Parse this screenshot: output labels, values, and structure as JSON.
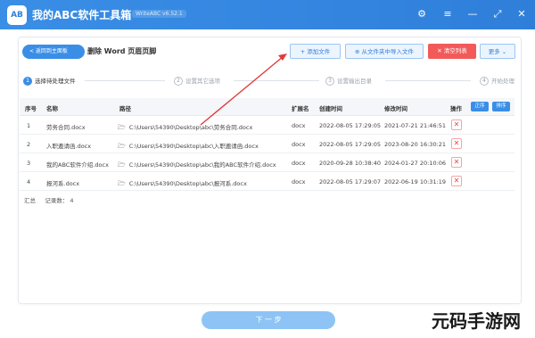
{
  "app": {
    "logo_text": "AB",
    "title": "我的ABC软件工具箱",
    "version": "WriteABC v6.52.1",
    "window_icons": [
      "settings-icon",
      "menu-icon",
      "minimize-icon",
      "maximize-icon",
      "close-icon"
    ]
  },
  "toolbar": {
    "back_label": "< 返回到主面板",
    "page_heading": "删除 Word 页眉页脚",
    "add_file_label": "+ 添加文件",
    "import_folder_label": "⊕ 从文件夹中导入文件",
    "clear_list_label": "✕ 清空列表",
    "more_label": "更多 ⌄"
  },
  "steps": [
    {
      "num": "1",
      "label": "选择待处理文件",
      "active": true
    },
    {
      "num": "2",
      "label": "设置其它选项",
      "active": false
    },
    {
      "num": "3",
      "label": "设置输出目录",
      "active": false
    },
    {
      "num": "4",
      "label": "开始处理",
      "active": false
    }
  ],
  "table": {
    "headers": {
      "index": "序号",
      "name": "名称",
      "path": "路径",
      "ext": "扩展名",
      "created": "创建时间",
      "modified": "修改时间",
      "action": "操作",
      "btn_a": "正序",
      "btn_b": "排序"
    },
    "rows": [
      {
        "index": "1",
        "name": "劳务合同.docx",
        "path": "C:\\Users\\54390\\Desktop\\abc\\劳务合同.docx",
        "ext": "docx",
        "created": "2022-08-05 17:29:05",
        "modified": "2021-07-21 21:46:51",
        "delete": "✕"
      },
      {
        "index": "2",
        "name": "入职邀请函.docx",
        "path": "C:\\Users\\54390\\Desktop\\abc\\入职邀请函.docx",
        "ext": "docx",
        "created": "2022-08-05 17:29:05",
        "modified": "2023-08-20 16:30:21",
        "delete": "✕"
      },
      {
        "index": "3",
        "name": "我的ABC软件介绍.docx",
        "path": "C:\\Users\\54390\\Desktop\\abc\\我的ABC软件介绍.docx",
        "ext": "docx",
        "created": "2020-09-28 10:38:40",
        "modified": "2024-01-27 20:10:06",
        "delete": "✕"
      },
      {
        "index": "4",
        "name": "报河系.docx",
        "path": "C:\\Users\\54390\\Desktop\\abc\\报河系.docx",
        "ext": "docx",
        "created": "2022-08-05 17:29:07",
        "modified": "2022-06-19 10:31:19",
        "delete": "✕"
      }
    ]
  },
  "summary": {
    "label": "汇总",
    "count_label": "记录数： 4"
  },
  "footer": {
    "next_label": "下 一 步"
  },
  "watermark": "元码手游网",
  "colors": {
    "accent": "#3a8ee6",
    "danger": "#f25a5a",
    "annotation_arrow": "#e23b3b"
  }
}
